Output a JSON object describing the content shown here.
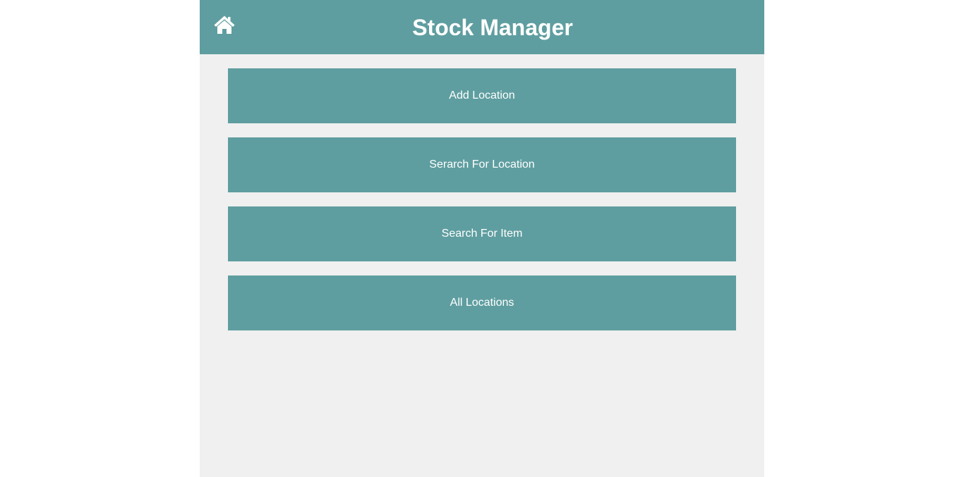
{
  "header": {
    "title": "Stock Manager",
    "home_icon": "home-icon"
  },
  "menu": {
    "items": [
      {
        "label": "Add Location"
      },
      {
        "label": "Serarch For Location"
      },
      {
        "label": "Search For Item"
      },
      {
        "label": "All Locations"
      }
    ]
  },
  "colors": {
    "accent": "#5f9ea0",
    "background": "#f0f0f0",
    "page": "#ffffff",
    "text_on_accent": "#ffffff"
  }
}
